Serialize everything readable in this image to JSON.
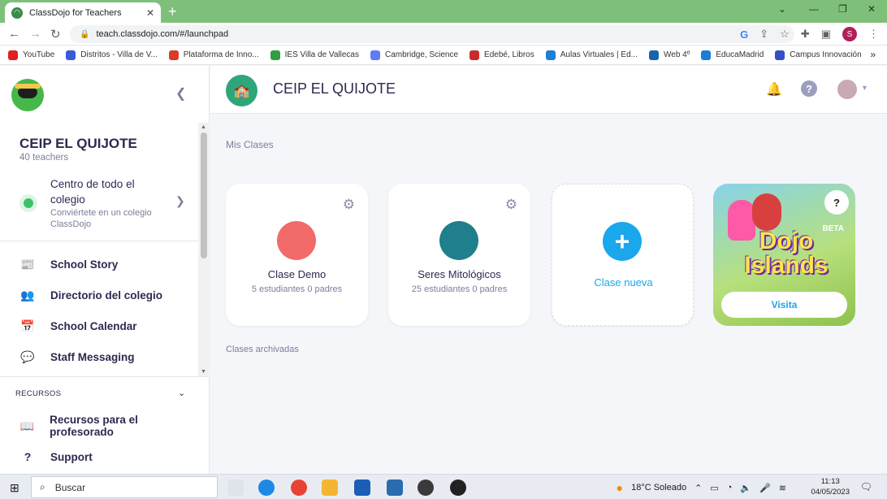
{
  "browser": {
    "tab_title": "ClassDojo for Teachers",
    "url": "teach.classdojo.com/#/launchpad",
    "profile_initial": "S",
    "bookmarks": [
      {
        "label": "YouTube",
        "color": "#e02020"
      },
      {
        "label": "Distritos - Villa de V...",
        "color": "#3b5bdb"
      },
      {
        "label": "Plataforma de Inno...",
        "color": "#d93a2b"
      },
      {
        "label": "IES Villa de Vallecas",
        "color": "#2f9e44"
      },
      {
        "label": "Cambridge, Science",
        "color": "#5c7cfa"
      },
      {
        "label": "Edebé, Libros",
        "color": "#c92a2a"
      },
      {
        "label": "Aulas Virtuales | Ed...",
        "color": "#1c7ed6"
      },
      {
        "label": "Web 4º",
        "color": "#1864ab"
      },
      {
        "label": "EducaMadrid",
        "color": "#1c7ed6"
      },
      {
        "label": "Campus Innovación",
        "color": "#364fc7"
      }
    ]
  },
  "sidebar": {
    "school_name": "CEIP EL QUIJOTE",
    "teachers": "40 teachers",
    "hub_title": "Centro de todo el colegio",
    "hub_sub": "Conviértete en un colegio ClassDojo",
    "items": [
      {
        "label": "School Story",
        "icon": "📰"
      },
      {
        "label": "Directorio del colegio",
        "icon": "👥"
      },
      {
        "label": "School Calendar",
        "icon": "📅"
      },
      {
        "label": "Staff Messaging",
        "icon": "💬"
      }
    ],
    "recursos_label": "RECURSOS",
    "resources": [
      {
        "label": "Recursos para el profesorado",
        "icon": "📖"
      },
      {
        "label": "Support",
        "icon": "?"
      }
    ]
  },
  "main": {
    "title": "CEIP EL QUIJOTE",
    "section_classes": "Mis Clases",
    "section_archived": "Clases archivadas",
    "classes": [
      {
        "name": "Clase Demo",
        "meta": "5 estudiantes 0 padres",
        "color": "#f26a6a"
      },
      {
        "name": "Seres Mitológicos",
        "meta": "25 estudiantes 0 padres",
        "color": "#1f7f8c"
      }
    ],
    "new_class_label": "Clase nueva",
    "promo": {
      "title": "Dojo Islands",
      "badge": "BETA",
      "help": "?",
      "button": "Visita"
    }
  },
  "taskbar": {
    "search_placeholder": "Buscar",
    "weather": "18°C  Soleado",
    "time": "11:13",
    "date": "04/05/2023"
  }
}
